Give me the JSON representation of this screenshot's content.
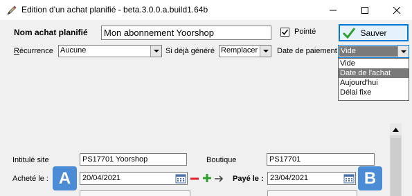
{
  "window": {
    "title": "Edition d'un achat planifié - beta.3.0.0.a.build1.64b",
    "controls": [
      "minimize",
      "maximize",
      "close"
    ]
  },
  "form": {
    "nom_label": "Nom achat planifié",
    "nom_value": "Mon abonnement Yoorshop",
    "pointe_label": "Pointé",
    "pointe_checked": true,
    "save_label": "Sauver",
    "recurrence_label": "Récurrence",
    "recurrence_value": "Aucune",
    "si_deja_label": "Si déjà généré",
    "si_deja_value": "Remplacer",
    "date_paiement_label": "Date de paiement",
    "date_paiement_value": "Vide",
    "date_paiement_options": [
      "Vide",
      "Date de l'achat",
      "Aujourd'hui",
      "Délai fixe"
    ],
    "date_paiement_highlighted": "Date de l'achat"
  },
  "details": {
    "intitule_label": "Intitulé site",
    "intitule_value": "PS17701 Yoorshop",
    "boutique_label": "Boutique",
    "boutique_value": "PS17701",
    "achete_label": "Acheté le :",
    "achete_value": "20/04/2021",
    "paye_label": "Payé le :",
    "paye_value": "23/04/2021"
  },
  "markers": {
    "a": "A",
    "b": "B"
  },
  "colors": {
    "accent": "#0078d7",
    "marker": "#4c8bd5",
    "minus": "#e0202a",
    "plus": "#2ea02e"
  }
}
